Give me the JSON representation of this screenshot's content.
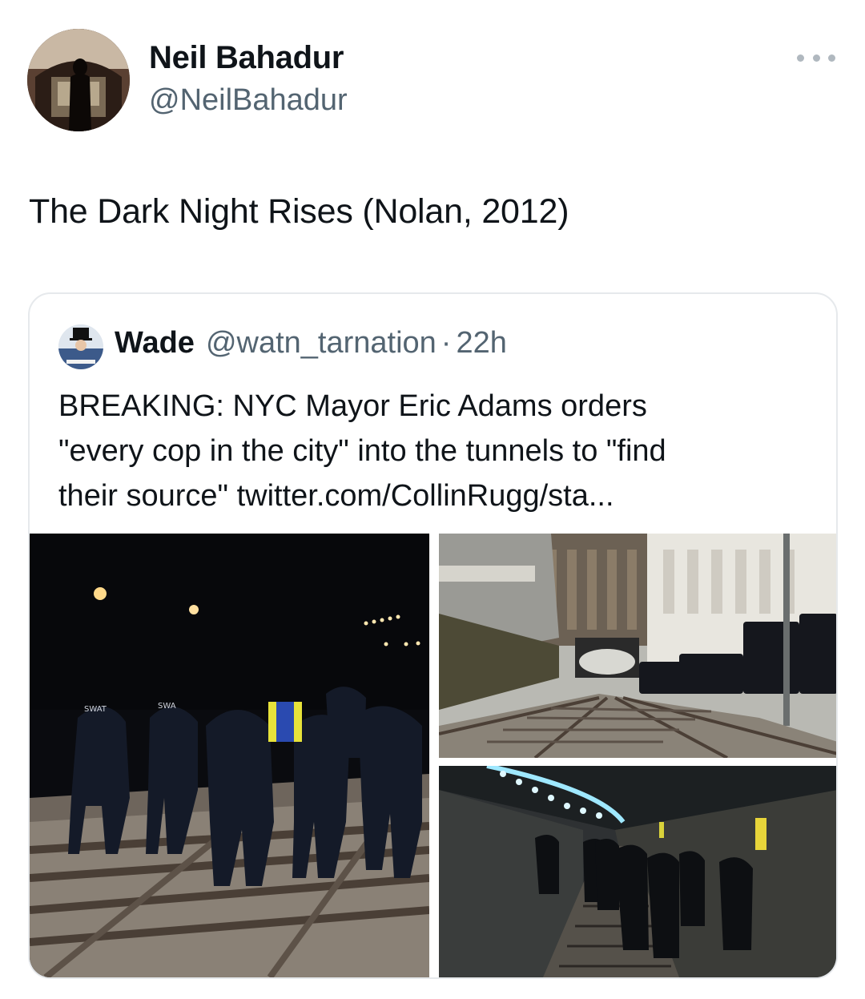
{
  "tweet": {
    "author_name": "Neil Bahadur",
    "author_handle": "@NeilBahadur",
    "text": "The Dark Night Rises (Nolan, 2012)",
    "more_icon": "more-horizontal-icon"
  },
  "quoted_tweet": {
    "author_name": "Wade",
    "author_handle": "@watn_tarnation",
    "separator": "·",
    "time": "22h",
    "text_lines": [
      "BREAKING: NYC Mayor Eric Adams orders",
      "\"every cop in the city\" into the tunnels to \"find",
      "their source\" twitter.com/CollinRugg/sta..."
    ],
    "images": [
      {
        "subject": "police officers walking on subway tracks at night"
      },
      {
        "subject": "police vehicles beside train tracks outside a station"
      },
      {
        "subject": "officers walking through a lit subway tunnel"
      }
    ]
  },
  "colors": {
    "text_primary": "#0f1419",
    "text_secondary": "#536471",
    "border": "#e6e9ec"
  }
}
